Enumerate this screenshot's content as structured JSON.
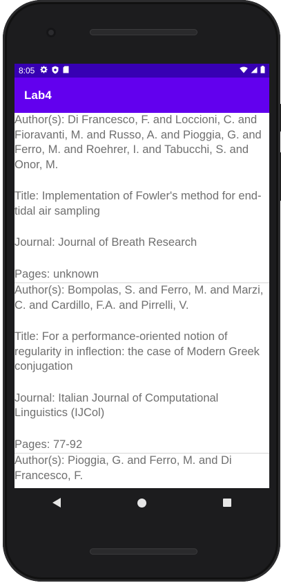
{
  "status_bar": {
    "time": "8:05",
    "left_icons": [
      "gear-icon",
      "shield-icon",
      "sd-card-icon"
    ],
    "right_icons": [
      "wifi-icon",
      "signal-icon",
      "battery-icon"
    ]
  },
  "app_bar": {
    "title": "Lab4"
  },
  "colors": {
    "status_bar": "#3700b3",
    "app_bar": "#6200ee",
    "text": "#6f6f6f"
  },
  "items": [
    {
      "authors": "Author(s): Di Francesco, F. and Loccioni, C. and Fioravanti, M. and Russo, A. and Pioggia, G. and Ferro, M. and Roehrer, I. and Tabucchi, S. and Onor, M.",
      "title": "Title: Implementation of Fowler's method for end-tidal air sampling",
      "journal": "Journal: Journal of Breath Research",
      "pages": "Pages: unknown"
    },
    {
      "authors": "Author(s): Bompolas, S. and Ferro, M. and Marzi, C. and Cardillo, F.A. and Pirrelli, V.",
      "title": "Title: For a performance-oriented notion of regularity in inflection: the case of Modern Greek conjugation",
      "journal": "Journal: Italian Journal of Computational Linguistics (IJCol)",
      "pages": "Pages: 77-92"
    },
    {
      "authors": "Author(s): Pioggia, G. and Ferro, M. and Di Francesco, F."
    }
  ]
}
